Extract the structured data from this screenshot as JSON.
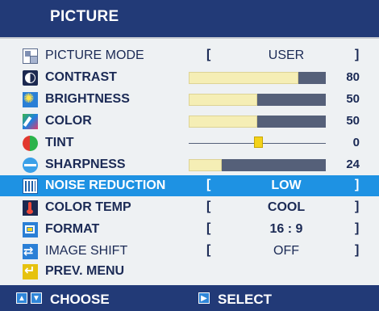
{
  "header": {
    "title": "PICTURE"
  },
  "colors": {
    "header_bg": "#223a77",
    "panel_bg": "#eef1f3",
    "selected_bg": "#1e92e3",
    "bar_fill": "#f5eeb5",
    "bar_track": "#556079",
    "tint_marker": "#f3d21a"
  },
  "menu": {
    "picture_mode": {
      "label": "PICTURE MODE",
      "value": "USER",
      "icon": "picture-mode-icon"
    },
    "contrast": {
      "label": "CONTRAST",
      "value": "80",
      "level": 80,
      "icon": "contrast-icon"
    },
    "brightness": {
      "label": "BRIGHTNESS",
      "value": "50",
      "level": 50,
      "icon": "brightness-icon"
    },
    "color": {
      "label": "COLOR",
      "value": "50",
      "level": 50,
      "icon": "color-icon"
    },
    "tint": {
      "label": "TINT",
      "value": "0",
      "level": 0,
      "icon": "tint-icon"
    },
    "sharpness": {
      "label": "SHARPNESS",
      "value": "24",
      "level": 24,
      "icon": "sharpness-icon"
    },
    "noise_reduction": {
      "label": "NOISE REDUCTION",
      "value": "LOW",
      "icon": "noise-reduction-icon",
      "selected": true
    },
    "color_temp": {
      "label": "COLOR TEMP",
      "value": "COOL",
      "icon": "thermometer-icon"
    },
    "format": {
      "label": "FORMAT",
      "value": "16 : 9",
      "icon": "format-icon"
    },
    "image_shift": {
      "label": "IMAGE SHIFT",
      "value": "OFF",
      "icon": "image-shift-icon"
    },
    "prev_menu": {
      "label": "PREV. MENU",
      "icon": "return-icon"
    }
  },
  "brackets": {
    "open": "[",
    "close": "]"
  },
  "footer": {
    "choose_label": "CHOOSE",
    "select_label": "SELECT",
    "choose_icons": [
      "up-arrow-icon",
      "down-arrow-icon"
    ],
    "select_icon": "right-arrow-icon"
  }
}
